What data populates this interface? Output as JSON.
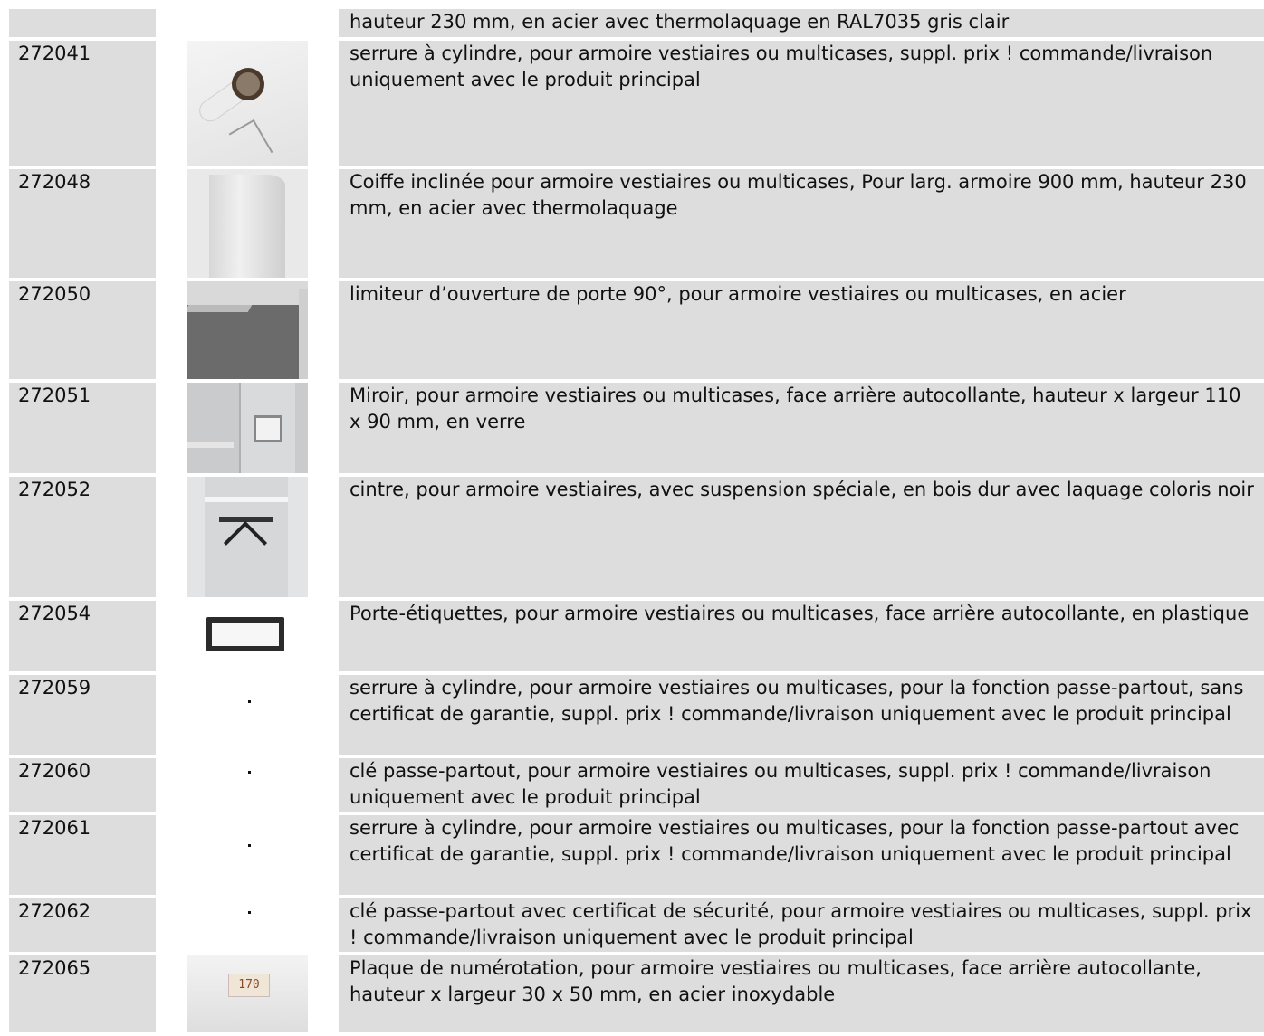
{
  "rows": [
    {
      "code": "",
      "description": "hauteur 230 mm, en acier avec thermolaquage en RAL7035 gris clair",
      "image": "none"
    },
    {
      "code": "272041",
      "description": "serrure à cylindre, pour armoire vestiaires ou multicases, suppl. prix ! commande/livraison uniquement avec le produit principal",
      "image": "cylinder-lock-photo"
    },
    {
      "code": "272048",
      "description": "Coiffe inclinée pour armoire vestiaires ou multicases, Pour larg. armoire 900 mm, hauteur 230 mm, en acier avec thermolaquage",
      "image": "sloped-top-photo"
    },
    {
      "code": "272050",
      "description": "limiteur d’ouverture de porte 90°, pour armoire vestiaires ou multicases, en acier",
      "image": "door-limiter-photo"
    },
    {
      "code": "272051",
      "description": "Miroir, pour armoire vestiaires ou multicases, face arrière autocollante, hauteur x largeur 110 x 90 mm, en verre",
      "image": "mirror-photo"
    },
    {
      "code": "272052",
      "description": "cintre, pour armoire vestiaires, avec suspension spéciale, en bois dur avec laquage coloris noir",
      "image": "hanger-photo"
    },
    {
      "code": "272054",
      "description": "Porte-étiquettes, pour armoire vestiaires ou multicases, face arrière autocollante, en plastique",
      "image": "label-holder-photo"
    },
    {
      "code": "272059",
      "description": "serrure à cylindre, pour armoire vestiaires ou multicases, pour la fonction passe-partout, sans certificat de garantie, suppl. prix ! commande/livraison uniquement avec le produit principal",
      "image": "dot"
    },
    {
      "code": "272060",
      "description": "clé passe-partout, pour armoire vestiaires ou multicases, suppl. prix ! commande/livraison uniquement avec le produit principal",
      "image": "dot"
    },
    {
      "code": "272061",
      "description": "serrure à cylindre, pour armoire vestiaires ou multicases, pour la fonction passe-partout avec certificat de garantie, suppl. prix ! commande/livraison uniquement avec le produit principal",
      "image": "dot"
    },
    {
      "code": "272062",
      "description": "clé passe-partout avec certificat de sécurité, pour armoire vestiaires ou multicases, suppl. prix ! commande/livraison uniquement avec le produit principal",
      "image": "dot"
    },
    {
      "code": "272065",
      "description": "Plaque de numérotation, pour armoire vestiaires ou multicases, face arrière autocollante, hauteur x largeur 30 x 50 mm, en acier inoxydable",
      "image": "number-plate-photo",
      "plate_text": "170"
    }
  ]
}
